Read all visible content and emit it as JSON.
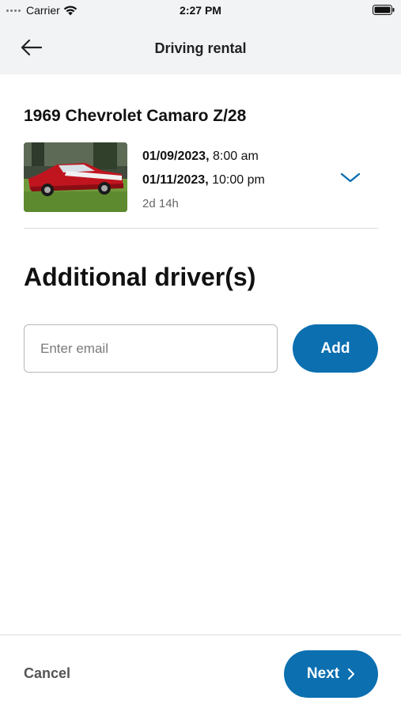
{
  "status_bar": {
    "carrier": "Carrier",
    "time": "2:27 PM"
  },
  "header": {
    "title": "Driving rental"
  },
  "booking": {
    "car_name": "1969 Chevrolet Camaro Z/28",
    "start_date": "01/09/2023,",
    "start_time": " 8:00 am",
    "end_date": "01/11/2023,",
    "end_time": " 10:00 pm",
    "duration": "2d 14h"
  },
  "drivers": {
    "title": "Additional driver(s)",
    "email_placeholder": "Enter email",
    "email_value": "",
    "add_label": "Add"
  },
  "footer": {
    "cancel_label": "Cancel",
    "next_label": "Next"
  },
  "colors": {
    "accent": "#0b6fb0",
    "header_bg": "#f2f3f5",
    "car_red": "#c0151f"
  },
  "icons": [
    "wifi-icon",
    "battery-icon",
    "back-arrow-icon",
    "chevron-down-icon",
    "chevron-right-icon"
  ]
}
